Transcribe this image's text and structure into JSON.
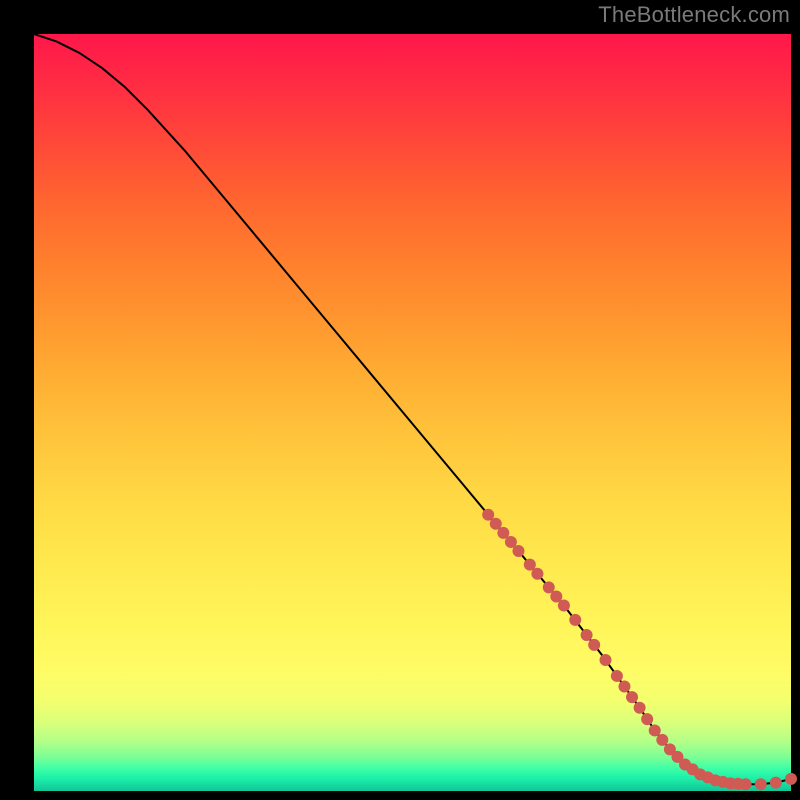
{
  "watermark": "TheBottleneck.com",
  "chart_data": {
    "type": "line",
    "title": "",
    "xlabel": "",
    "ylabel": "",
    "xlim": [
      0,
      100
    ],
    "ylim": [
      0,
      100
    ],
    "grid": false,
    "legend": false,
    "series": [
      {
        "name": "curve",
        "color": "#000000",
        "x": [
          0,
          3,
          6,
          9,
          12,
          15,
          20,
          25,
          30,
          35,
          40,
          45,
          50,
          55,
          60,
          65,
          70,
          75,
          80,
          82,
          84,
          86,
          88,
          90,
          92,
          94,
          96,
          98,
          100
        ],
        "y": [
          100,
          99,
          97.5,
          95.5,
          93,
          90,
          84.5,
          78.5,
          72.5,
          66.5,
          60.5,
          54.5,
          48.5,
          42.5,
          36.5,
          30.5,
          24.5,
          18.0,
          11.0,
          8.0,
          5.5,
          3.5,
          2.2,
          1.4,
          1.0,
          0.9,
          0.9,
          1.1,
          1.6
        ]
      }
    ],
    "markers": [
      {
        "x": 60.0,
        "y": 36.5
      },
      {
        "x": 61.0,
        "y": 35.3
      },
      {
        "x": 62.0,
        "y": 34.1
      },
      {
        "x": 63.0,
        "y": 32.9
      },
      {
        "x": 64.0,
        "y": 31.7
      },
      {
        "x": 65.5,
        "y": 29.9
      },
      {
        "x": 66.5,
        "y": 28.7
      },
      {
        "x": 68.0,
        "y": 26.9
      },
      {
        "x": 69.0,
        "y": 25.7
      },
      {
        "x": 70.0,
        "y": 24.5
      },
      {
        "x": 71.5,
        "y": 22.6
      },
      {
        "x": 73.0,
        "y": 20.6
      },
      {
        "x": 74.0,
        "y": 19.3
      },
      {
        "x": 75.5,
        "y": 17.3
      },
      {
        "x": 77.0,
        "y": 15.2
      },
      {
        "x": 78.0,
        "y": 13.8
      },
      {
        "x": 79.0,
        "y": 12.4
      },
      {
        "x": 80.0,
        "y": 11.0
      },
      {
        "x": 81.0,
        "y": 9.5
      },
      {
        "x": 82.0,
        "y": 8.0
      },
      {
        "x": 83.0,
        "y": 6.75
      },
      {
        "x": 84.0,
        "y": 5.5
      },
      {
        "x": 85.0,
        "y": 4.5
      },
      {
        "x": 86.0,
        "y": 3.5
      },
      {
        "x": 87.0,
        "y": 2.85
      },
      {
        "x": 88.0,
        "y": 2.2
      },
      {
        "x": 89.0,
        "y": 1.8
      },
      {
        "x": 90.0,
        "y": 1.4
      },
      {
        "x": 91.0,
        "y": 1.2
      },
      {
        "x": 92.0,
        "y": 1.0
      },
      {
        "x": 93.0,
        "y": 0.95
      },
      {
        "x": 94.0,
        "y": 0.9
      },
      {
        "x": 96.0,
        "y": 0.9
      },
      {
        "x": 98.0,
        "y": 1.1
      },
      {
        "x": 100.0,
        "y": 1.6
      }
    ],
    "marker_color": "#cf5b54",
    "marker_radius_px": 6
  }
}
